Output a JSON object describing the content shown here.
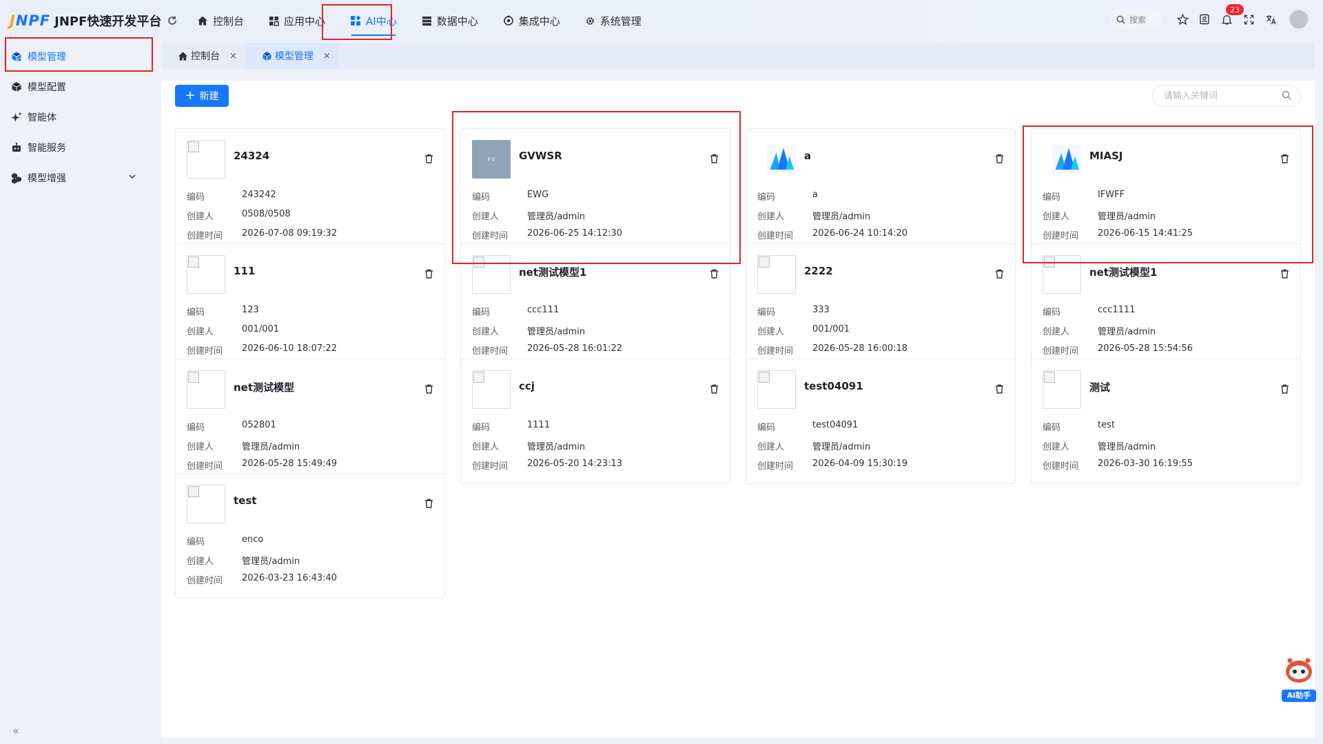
{
  "app": {
    "logo_mark_j": "J",
    "logo_mark_rest": "NPF",
    "title": "JNPF快速开发平台"
  },
  "nav": {
    "items": [
      {
        "label": "控制台",
        "icon": "home-icon"
      },
      {
        "label": "应用中心",
        "icon": "grid-icon"
      },
      {
        "label": "AI中心",
        "icon": "apps-icon",
        "active": true
      },
      {
        "label": "数据中心",
        "icon": "database-icon"
      },
      {
        "label": "集成中心",
        "icon": "integration-icon"
      },
      {
        "label": "系统管理",
        "icon": "gear-icon"
      }
    ]
  },
  "top_right": {
    "search_label": "搜索",
    "notification_count": "23"
  },
  "sidebar": {
    "items": [
      {
        "label": "模型管理",
        "icon": "cube-icon",
        "active": true
      },
      {
        "label": "模型配置",
        "icon": "box-icon"
      },
      {
        "label": "智能体",
        "icon": "sparkle-icon"
      },
      {
        "label": "智能服务",
        "icon": "robot-icon"
      },
      {
        "label": "模型增强",
        "icon": "cubes-icon",
        "has_children": true
      }
    ],
    "collapse_label": "«"
  },
  "tabs": [
    {
      "label": "控制台",
      "close": "×"
    },
    {
      "label": "模型管理",
      "close": "×",
      "active": true
    }
  ],
  "toolbar": {
    "new_label": "新建",
    "new_plus": "+",
    "search_placeholder": "请输入关键词"
  },
  "labels": {
    "code": "编码",
    "creator": "创建人",
    "created_time": "创建时间"
  },
  "cards": [
    {
      "name": "24324",
      "code": "243242",
      "creator": "0508/0508",
      "time": "2026-07-08 09:19:32",
      "thumb": "broken"
    },
    {
      "name": "GVWSR",
      "code": "EWG",
      "creator": "管理员/admin",
      "time": "2026-06-25 14:12:30",
      "thumb": "gray",
      "thumb_text": "ꜰıı"
    },
    {
      "name": "a",
      "code": "a",
      "creator": "管理员/admin",
      "time": "2026-06-24 10:14:20",
      "thumb": "logo"
    },
    {
      "name": "MIASJ",
      "code": "IFWFF",
      "creator": "管理员/admin",
      "time": "2026-06-15 14:41:25",
      "thumb": "logo"
    },
    {
      "name": "111",
      "code": "123",
      "creator": "001/001",
      "time": "2026-06-10 18:07:22",
      "thumb": "broken"
    },
    {
      "name": "net测试模型1",
      "code": "ccc111",
      "creator": "管理员/admin",
      "time": "2026-05-28 16:01:22",
      "thumb": "broken"
    },
    {
      "name": "2222",
      "code": "333",
      "creator": "001/001",
      "time": "2026-05-28 16:00:18",
      "thumb": "broken"
    },
    {
      "name": "net测试模型1",
      "code": "ccc1111",
      "creator": "管理员/admin",
      "time": "2026-05-28 15:54:56",
      "thumb": "broken"
    },
    {
      "name": "net测试模型",
      "code": "052801",
      "creator": "管理员/admin",
      "time": "2026-05-28 15:49:49",
      "thumb": "broken"
    },
    {
      "name": "ccj",
      "code": "1111",
      "creator": "管理员/admin",
      "time": "2026-05-20 14:23:13",
      "thumb": "broken"
    },
    {
      "name": "test04091",
      "code": "test04091",
      "creator": "管理员/admin",
      "time": "2026-04-09 15:30:19",
      "thumb": "broken"
    },
    {
      "name": "测试",
      "code": "test",
      "creator": "管理员/admin",
      "time": "2026-03-30 16:19:55",
      "thumb": "broken"
    },
    {
      "name": "test",
      "code": "enco",
      "creator": "管理员/admin",
      "time": "2026-03-23 16:43:40",
      "thumb": "broken"
    }
  ],
  "ai_helper": {
    "label": "AI助手"
  },
  "colors": {
    "accent": "#1677ff",
    "highlight": "#e02424",
    "badge": "#f5222d"
  }
}
